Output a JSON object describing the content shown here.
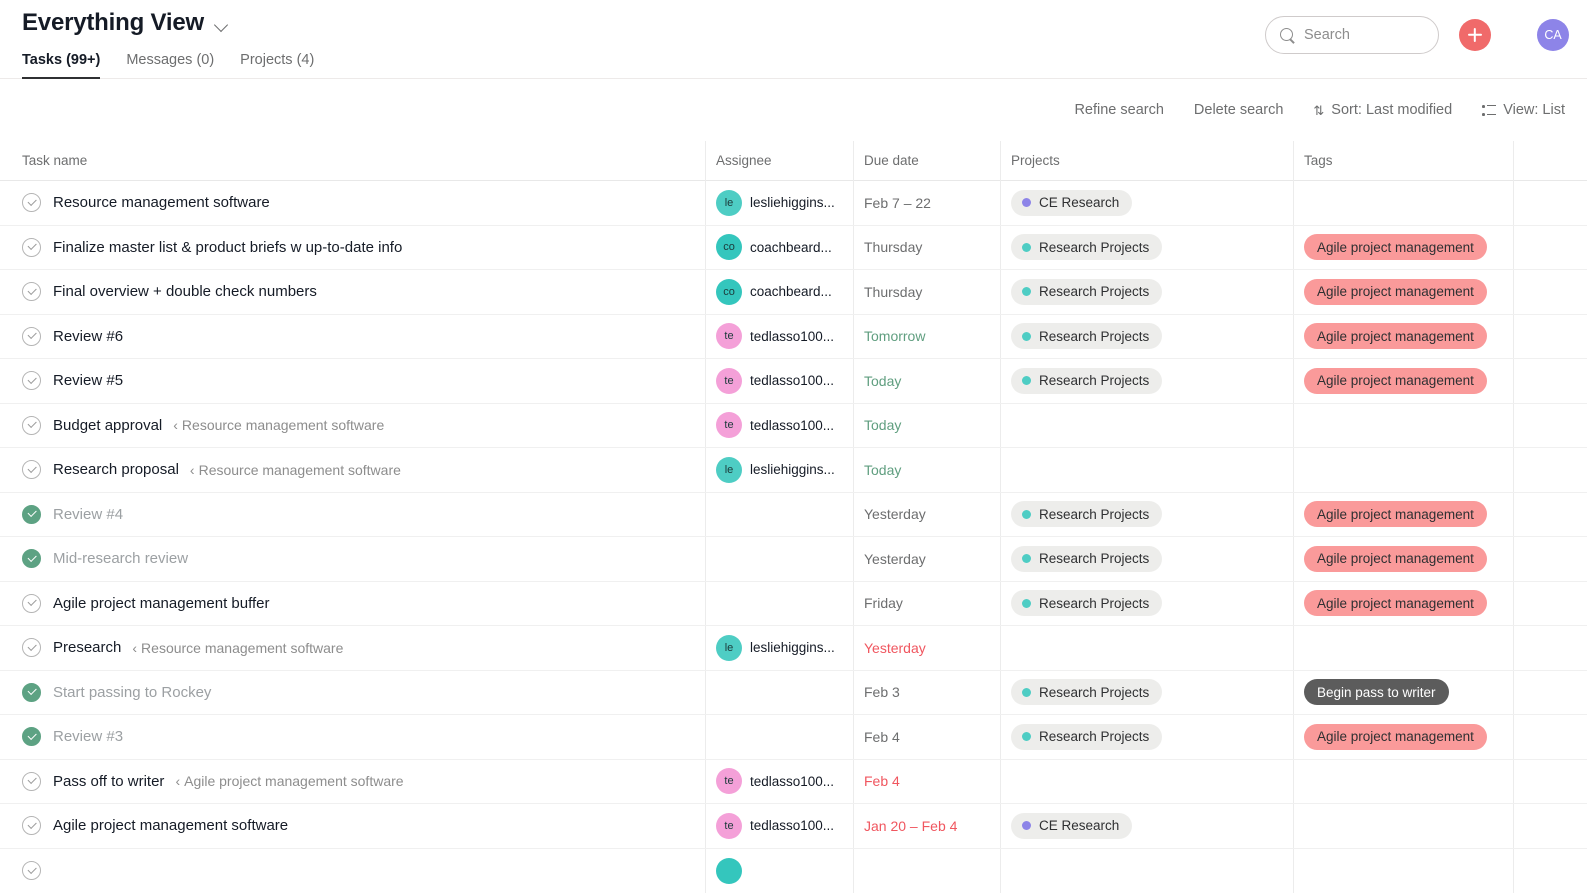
{
  "header": {
    "title": "Everything View",
    "chevron_icon": "chevron-down-icon",
    "tabs": [
      {
        "label": "Tasks (99+)",
        "active": true
      },
      {
        "label": "Messages (0)",
        "active": false
      },
      {
        "label": "Projects (4)",
        "active": false
      }
    ]
  },
  "search": {
    "placeholder": "Search",
    "value": "",
    "icon": "search-icon"
  },
  "add_button": {
    "icon": "plus-icon",
    "color": "#f06a6a"
  },
  "avatar": {
    "initials": "CA",
    "color": "#8d84e8"
  },
  "toolbar": {
    "refine_search": "Refine search",
    "delete_search": "Delete search",
    "sort": "Sort: Last modified",
    "sort_icon": "sort-arrows-icon",
    "view": "View: List",
    "view_icon": "list-view-icon"
  },
  "columns": [
    "Task name",
    "Assignee",
    "Due date",
    "Projects",
    "Tags"
  ],
  "colors": {
    "accent_red": "#f06a6a",
    "tag_salmon": "#fa9a9a",
    "tag_dark": "#5c5c5c",
    "project_teal": "#4ecdc4",
    "project_purple": "#8d84e8",
    "done_green": "#5da283",
    "due_green": "#5f9e7f",
    "due_red": "#f0565f",
    "avatar_teal_light": "#4ecdc4",
    "avatar_teal_dark": "#34c6bd",
    "avatar_pink": "#f4a0d8"
  },
  "rows": [
    {
      "name": "Resource management software",
      "parent": "",
      "done": false,
      "assignee": {
        "initials": "le",
        "name": "lesliehiggins...",
        "color": "#4ecdc4"
      },
      "due": {
        "text": "Feb 7 – 22",
        "state": "normal"
      },
      "project": {
        "label": "CE Research",
        "dot": "#8d84e8"
      },
      "tag": null
    },
    {
      "name": "Finalize master list & product briefs w up-to-date info",
      "parent": "",
      "done": false,
      "assignee": {
        "initials": "co",
        "name": "coachbeard...",
        "color": "#34c6bd"
      },
      "due": {
        "text": "Thursday",
        "state": "normal"
      },
      "project": {
        "label": "Research Projects",
        "dot": "#4ecdc4"
      },
      "tag": {
        "label": "Agile project management",
        "bg": "#fa9a9a",
        "fg": "#2f3032"
      }
    },
    {
      "name": "Final overview + double check numbers",
      "parent": "",
      "done": false,
      "assignee": {
        "initials": "co",
        "name": "coachbeard...",
        "color": "#34c6bd"
      },
      "due": {
        "text": "Thursday",
        "state": "normal"
      },
      "project": {
        "label": "Research Projects",
        "dot": "#4ecdc4"
      },
      "tag": {
        "label": "Agile project management",
        "bg": "#fa9a9a",
        "fg": "#2f3032"
      }
    },
    {
      "name": "Review #6",
      "parent": "",
      "done": false,
      "assignee": {
        "initials": "te",
        "name": "tedlasso100...",
        "color": "#f4a0d8"
      },
      "due": {
        "text": "Tomorrow",
        "state": "green"
      },
      "project": {
        "label": "Research Projects",
        "dot": "#4ecdc4"
      },
      "tag": {
        "label": "Agile project management",
        "bg": "#fa9a9a",
        "fg": "#2f3032"
      }
    },
    {
      "name": "Review #5",
      "parent": "",
      "done": false,
      "assignee": {
        "initials": "te",
        "name": "tedlasso100...",
        "color": "#f4a0d8"
      },
      "due": {
        "text": "Today",
        "state": "green"
      },
      "project": {
        "label": "Research Projects",
        "dot": "#4ecdc4"
      },
      "tag": {
        "label": "Agile project management",
        "bg": "#fa9a9a",
        "fg": "#2f3032"
      }
    },
    {
      "name": "Budget approval",
      "parent": "Resource management software",
      "done": false,
      "assignee": {
        "initials": "te",
        "name": "tedlasso100...",
        "color": "#f4a0d8"
      },
      "due": {
        "text": "Today",
        "state": "green"
      },
      "project": null,
      "tag": null
    },
    {
      "name": "Research proposal",
      "parent": "Resource management software",
      "done": false,
      "assignee": {
        "initials": "le",
        "name": "lesliehiggins...",
        "color": "#4ecdc4"
      },
      "due": {
        "text": "Today",
        "state": "green"
      },
      "project": null,
      "tag": null
    },
    {
      "name": "Review #4",
      "parent": "",
      "done": true,
      "assignee": null,
      "due": {
        "text": "Yesterday",
        "state": "normal"
      },
      "project": {
        "label": "Research Projects",
        "dot": "#4ecdc4"
      },
      "tag": {
        "label": "Agile project management",
        "bg": "#fa9a9a",
        "fg": "#2f3032"
      }
    },
    {
      "name": "Mid-research review",
      "parent": "",
      "done": true,
      "assignee": null,
      "due": {
        "text": "Yesterday",
        "state": "normal"
      },
      "project": {
        "label": "Research Projects",
        "dot": "#4ecdc4"
      },
      "tag": {
        "label": "Agile project management",
        "bg": "#fa9a9a",
        "fg": "#2f3032"
      }
    },
    {
      "name": "Agile project management buffer",
      "parent": "",
      "done": false,
      "assignee": null,
      "due": {
        "text": "Friday",
        "state": "normal"
      },
      "project": {
        "label": "Research Projects",
        "dot": "#4ecdc4"
      },
      "tag": {
        "label": "Agile project management",
        "bg": "#fa9a9a",
        "fg": "#2f3032"
      }
    },
    {
      "name": "Presearch",
      "parent": "Resource management software",
      "done": false,
      "assignee": {
        "initials": "le",
        "name": "lesliehiggins...",
        "color": "#4ecdc4"
      },
      "due": {
        "text": "Yesterday",
        "state": "red"
      },
      "project": null,
      "tag": null
    },
    {
      "name": "Start passing to Rockey",
      "parent": "",
      "done": true,
      "assignee": null,
      "due": {
        "text": "Feb 3",
        "state": "normal"
      },
      "project": {
        "label": "Research Projects",
        "dot": "#4ecdc4"
      },
      "tag": {
        "label": "Begin pass to writer",
        "bg": "#5c5c5c",
        "fg": "#ffffff"
      }
    },
    {
      "name": "Review #3",
      "parent": "",
      "done": true,
      "assignee": null,
      "due": {
        "text": "Feb 4",
        "state": "normal"
      },
      "project": {
        "label": "Research Projects",
        "dot": "#4ecdc4"
      },
      "tag": {
        "label": "Agile project management",
        "bg": "#fa9a9a",
        "fg": "#2f3032"
      }
    },
    {
      "name": "Pass off to writer",
      "parent": "Agile project management software",
      "done": false,
      "assignee": {
        "initials": "te",
        "name": "tedlasso100...",
        "color": "#f4a0d8"
      },
      "due": {
        "text": "Feb 4",
        "state": "red"
      },
      "project": null,
      "tag": null
    },
    {
      "name": "Agile project management software",
      "parent": "",
      "done": false,
      "assignee": {
        "initials": "te",
        "name": "tedlasso100...",
        "color": "#f4a0d8"
      },
      "due": {
        "text": "Jan 20 – Feb 4",
        "state": "red"
      },
      "project": {
        "label": "CE Research",
        "dot": "#8d84e8"
      },
      "tag": null
    },
    {
      "name": "",
      "parent": "",
      "done": false,
      "partial": true,
      "assignee": {
        "initials": "",
        "name": "",
        "color": "#34c6bd"
      },
      "due": {
        "text": "",
        "state": "red"
      },
      "project": null,
      "tag": null
    }
  ]
}
